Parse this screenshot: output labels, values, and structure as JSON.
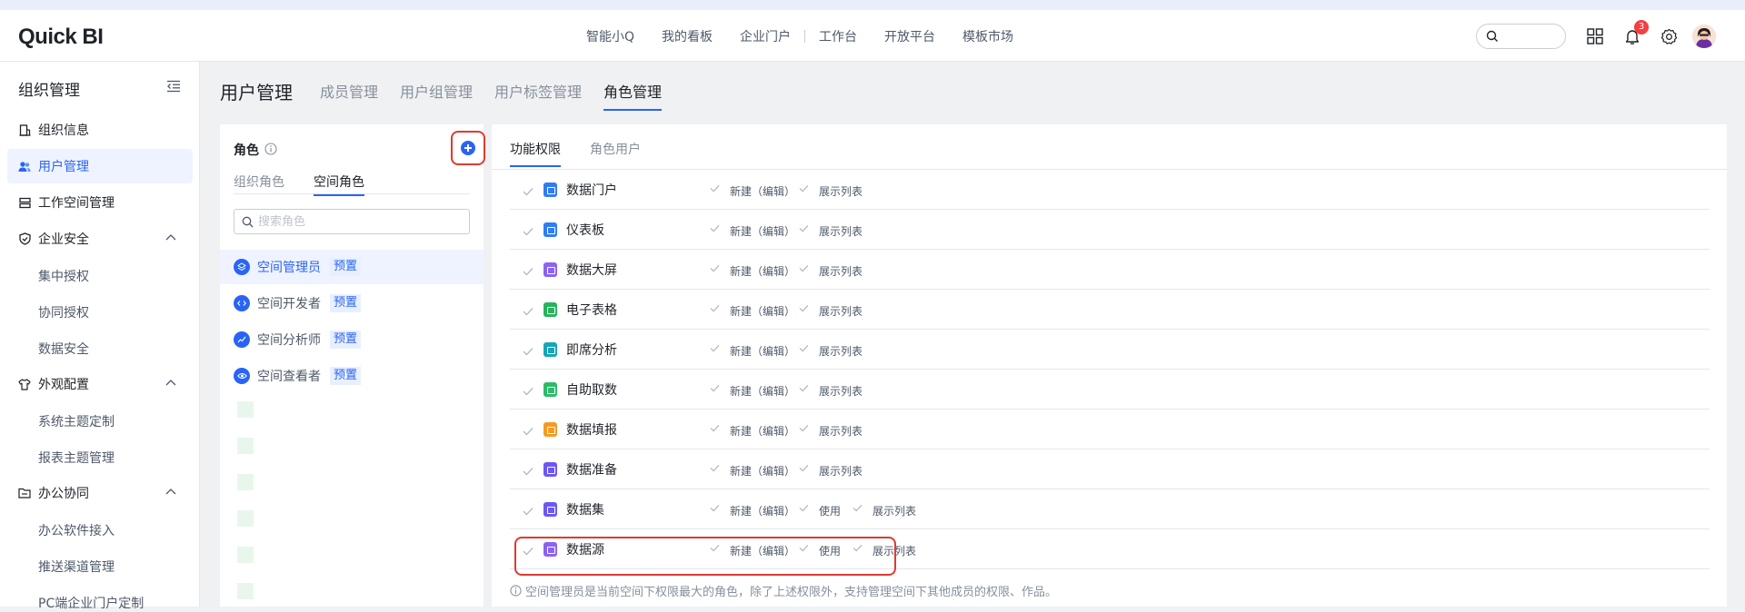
{
  "app": {
    "logo": "Quick BI"
  },
  "nav": [
    "智能小Q",
    "我的看板",
    "企业门户",
    "工作台",
    "开放平台",
    "模板市场"
  ],
  "notification_count": "3",
  "sidebar": {
    "title": "组织管理",
    "items": [
      {
        "label": "组织信息",
        "icon": "building-icon"
      },
      {
        "label": "用户管理",
        "icon": "users-icon",
        "active": true
      },
      {
        "label": "工作空间管理",
        "icon": "workspace-icon"
      },
      {
        "label": "企业安全",
        "icon": "shield-icon",
        "expanded": true
      },
      {
        "label": "集中授权",
        "sub": true
      },
      {
        "label": "协同授权",
        "sub": true
      },
      {
        "label": "数据安全",
        "sub": true
      },
      {
        "label": "外观配置",
        "icon": "shirt-icon",
        "expanded": true
      },
      {
        "label": "系统主题定制",
        "sub": true
      },
      {
        "label": "报表主题管理",
        "sub": true
      },
      {
        "label": "办公协同",
        "icon": "office-icon",
        "expanded": true
      },
      {
        "label": "办公软件接入",
        "sub": true
      },
      {
        "label": "推送渠道管理",
        "sub": true
      },
      {
        "label": "PC端企业门户定制",
        "sub": true
      }
    ]
  },
  "page": {
    "title": "用户管理",
    "tabs": [
      "成员管理",
      "用户组管理",
      "用户标签管理",
      "角色管理"
    ],
    "active_tab": "角色管理"
  },
  "roles_panel": {
    "title": "角色",
    "segments": [
      "组织角色",
      "空间角色"
    ],
    "active_segment": "空间角色",
    "search_placeholder": "搜索角色",
    "roles": [
      {
        "name": "空间管理员",
        "tag": "预置",
        "icon": "layers-icon",
        "active": true
      },
      {
        "name": "空间开发者",
        "tag": "预置",
        "icon": "code-icon"
      },
      {
        "name": "空间分析师",
        "tag": "预置",
        "icon": "chart-icon"
      },
      {
        "name": "空间查看者",
        "tag": "预置",
        "icon": "eye-icon"
      }
    ]
  },
  "perm_panel": {
    "tabs": [
      "功能权限",
      "角色用户"
    ],
    "active_tab": "功能权限",
    "rows": [
      {
        "module": "数据门户",
        "icon_color": "#2f7cf6",
        "actions": [
          "新建（编辑）",
          "展示列表"
        ]
      },
      {
        "module": "仪表板",
        "icon_color": "#2f7cf6",
        "actions": [
          "新建（编辑）",
          "展示列表"
        ]
      },
      {
        "module": "数据大屏",
        "icon_color": "#8a63f5",
        "actions": [
          "新建（编辑）",
          "展示列表"
        ]
      },
      {
        "module": "电子表格",
        "icon_color": "#27b35c",
        "actions": [
          "新建（编辑）",
          "展示列表"
        ]
      },
      {
        "module": "即席分析",
        "icon_color": "#16a5b8",
        "actions": [
          "新建（编辑）",
          "展示列表"
        ]
      },
      {
        "module": "自助取数",
        "icon_color": "#2dbb6a",
        "actions": [
          "新建（编辑）",
          "展示列表"
        ]
      },
      {
        "module": "数据填报",
        "icon_color": "#f59a23",
        "actions": [
          "新建（编辑）",
          "展示列表"
        ]
      },
      {
        "module": "数据准备",
        "icon_color": "#6b57f5",
        "actions": [
          "新建（编辑）",
          "展示列表"
        ]
      },
      {
        "module": "数据集",
        "icon_color": "#6b57f5",
        "actions": [
          "新建（编辑）",
          "使用",
          "展示列表"
        ]
      },
      {
        "module": "数据源",
        "icon_color": "#8a63f5",
        "actions": [
          "新建（编辑）",
          "使用",
          "展示列表"
        ]
      }
    ],
    "note": "空间管理员是当前空间下权限最大的角色，除了上述权限外，支持管理空间下其他成员的权限、作品。"
  },
  "colors": {
    "accent": "#2a64f6",
    "highlight_box": "#e03a2f",
    "badge": "#f53f3f"
  }
}
